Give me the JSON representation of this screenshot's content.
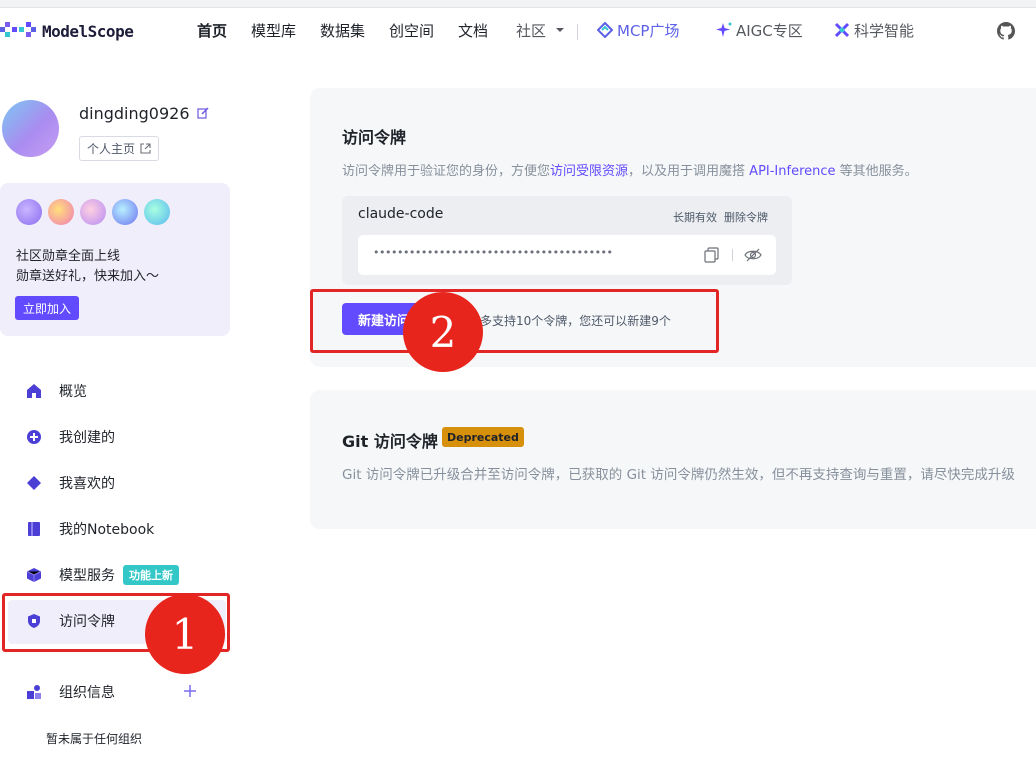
{
  "brand": {
    "name": "ModelScope"
  },
  "nav": {
    "items": [
      "首页",
      "模型库",
      "数据集",
      "创空间",
      "文档",
      "社区"
    ],
    "mcp": "MCP广场",
    "aigc": "AIGC专区",
    "science": "科学智能"
  },
  "profile": {
    "username": "dingding0926",
    "home_button": "个人主页"
  },
  "promo": {
    "line1": "社区勋章全面上线",
    "line2": "勋章送好礼，快来加入～",
    "join": "立即加入"
  },
  "sidebar": {
    "items": [
      {
        "label": "概览"
      },
      {
        "label": "我创建的"
      },
      {
        "label": "我喜欢的"
      },
      {
        "label": "我的Notebook"
      },
      {
        "label": "模型服务",
        "tag": "功能上新"
      },
      {
        "label": "访问令牌"
      },
      {
        "label": "组织信息"
      }
    ],
    "org_note": "暂未属于任何组织"
  },
  "access_token": {
    "title": "访问令牌",
    "desc_pre": "访问令牌用于验证您的身份，方便您",
    "desc_link1": "访问受限资源",
    "desc_mid": "，以及用于调用魔搭 ",
    "desc_link2": "API-Inference",
    "desc_post": " 等其他服务。",
    "token_name": "claude-code",
    "validity": "长期有效",
    "delete": "删除令牌",
    "masked_value": "••••••••••••••••••••••••••••••••••••••••",
    "new_button": "新建访问",
    "limit_text": "多支持10个令牌，您还可以新建9个"
  },
  "git_token": {
    "title": "Git 访问令牌",
    "tag": "Deprecated",
    "desc": "Git 访问令牌已升级合并至访问令牌，已获取的 Git 访问令牌仍然生效，但不再支持查询与重置，请尽快完成升级"
  },
  "annotations": {
    "marker1": "1",
    "marker2": "2"
  }
}
